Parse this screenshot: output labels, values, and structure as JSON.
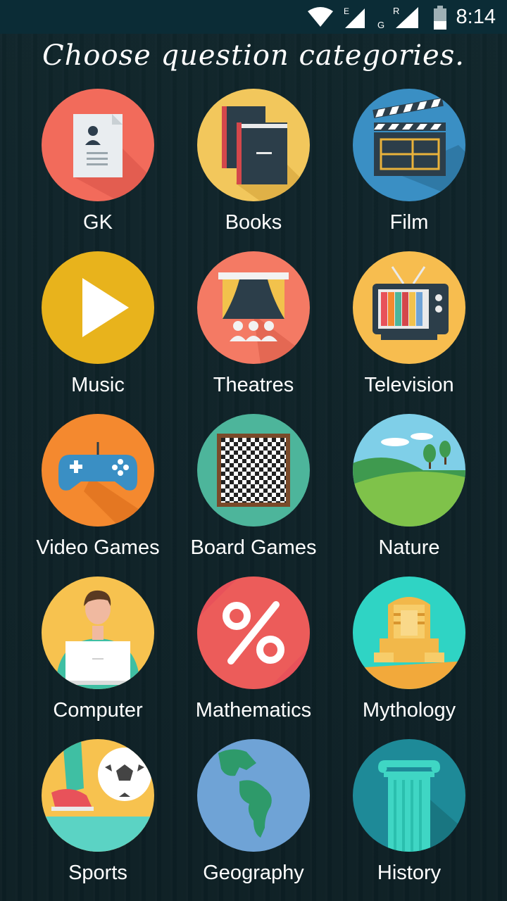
{
  "status_bar": {
    "time": "8:14",
    "network_e": "E",
    "network_g": "G",
    "network_r": "R"
  },
  "title": "Choose question categories.",
  "categories": [
    {
      "label": "GK",
      "icon": "profile-document-icon",
      "color": "#f26b5b"
    },
    {
      "label": "Books",
      "icon": "books-icon",
      "color": "#f2c75c"
    },
    {
      "label": "Film",
      "icon": "clapperboard-icon",
      "color": "#3a8fc4"
    },
    {
      "label": "Music",
      "icon": "play-icon",
      "color": "#e8b31c"
    },
    {
      "label": "Theatres",
      "icon": "theatre-stage-icon",
      "color": "#f47a64"
    },
    {
      "label": "Television",
      "icon": "television-icon",
      "color": "#f7bd4f"
    },
    {
      "label": "Video Games",
      "icon": "gamepad-icon",
      "color": "#f4892f"
    },
    {
      "label": "Board Games",
      "icon": "chessboard-icon",
      "color": "#4db59b"
    },
    {
      "label": "Nature",
      "icon": "landscape-icon",
      "color": "#7fcfe8"
    },
    {
      "label": "Computer",
      "icon": "person-laptop-icon",
      "color": "#f7c24f"
    },
    {
      "label": "Mathematics",
      "icon": "percent-icon",
      "color": "#e8525a"
    },
    {
      "label": "Mythology",
      "icon": "sphinx-icon",
      "color": "#2fd4c4"
    },
    {
      "label": "Sports",
      "icon": "football-kick-icon",
      "color": "#f7c24f"
    },
    {
      "label": "Geography",
      "icon": "globe-icon",
      "color": "#6fa3d6"
    },
    {
      "label": "History",
      "icon": "column-icon",
      "color": "#1e8a98"
    }
  ]
}
